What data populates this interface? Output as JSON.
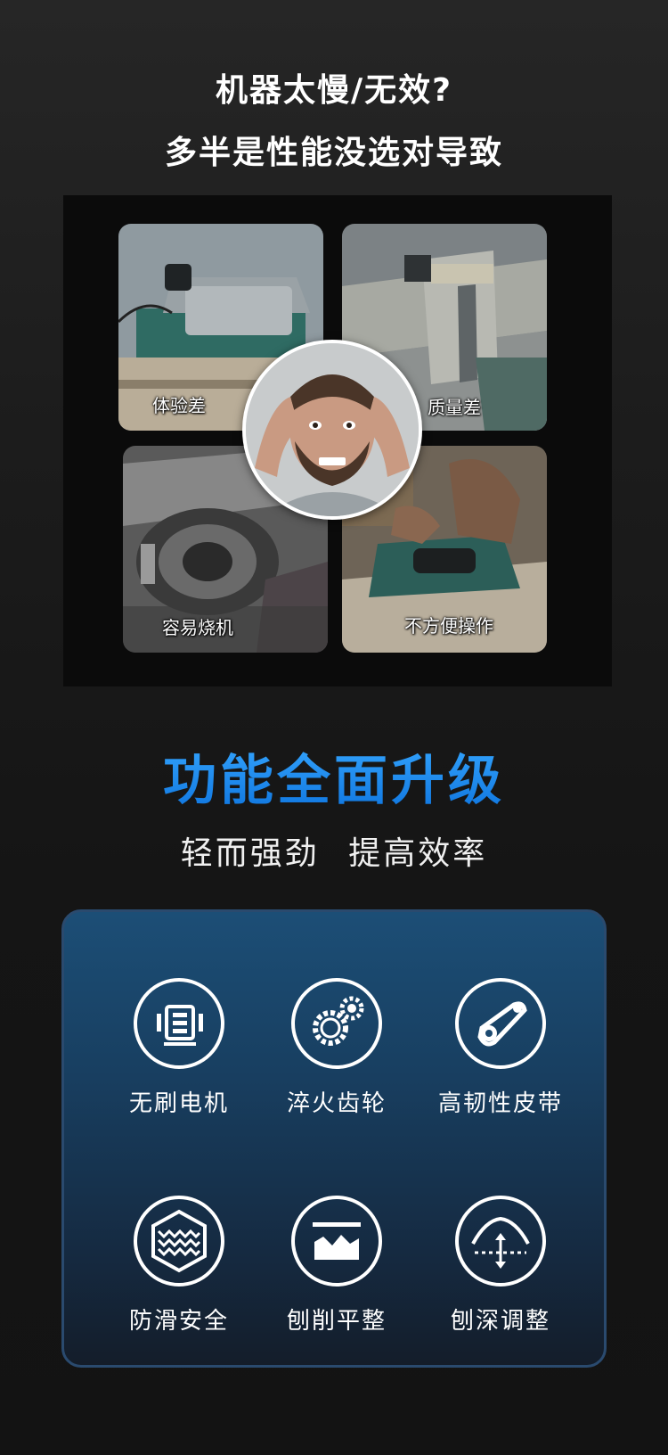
{
  "headline": {
    "line1": "机器太慢/无效?",
    "line2": "多半是性能没选对导致"
  },
  "pain_points": [
    {
      "label": "体验差"
    },
    {
      "label": "质量差"
    },
    {
      "label": "容易烧机"
    },
    {
      "label": "不方便操作"
    }
  ],
  "upgrade": {
    "title": "功能全面升级",
    "subtitle": "轻而强劲  提高效率"
  },
  "features": [
    {
      "label": "无刷电机",
      "icon": "brushless-motor-icon"
    },
    {
      "label": "淬火齿轮",
      "icon": "gears-icon"
    },
    {
      "label": "高韧性皮带",
      "icon": "belt-pulley-icon"
    },
    {
      "label": "防滑安全",
      "icon": "anti-slip-icon"
    },
    {
      "label": "刨削平整",
      "icon": "flat-planing-icon"
    },
    {
      "label": "刨深调整",
      "icon": "depth-adjust-icon"
    }
  ],
  "colors": {
    "background": "#1c1c1c",
    "accent_blue": "#1e8cf0",
    "panel_blue": "#1c4e76"
  }
}
